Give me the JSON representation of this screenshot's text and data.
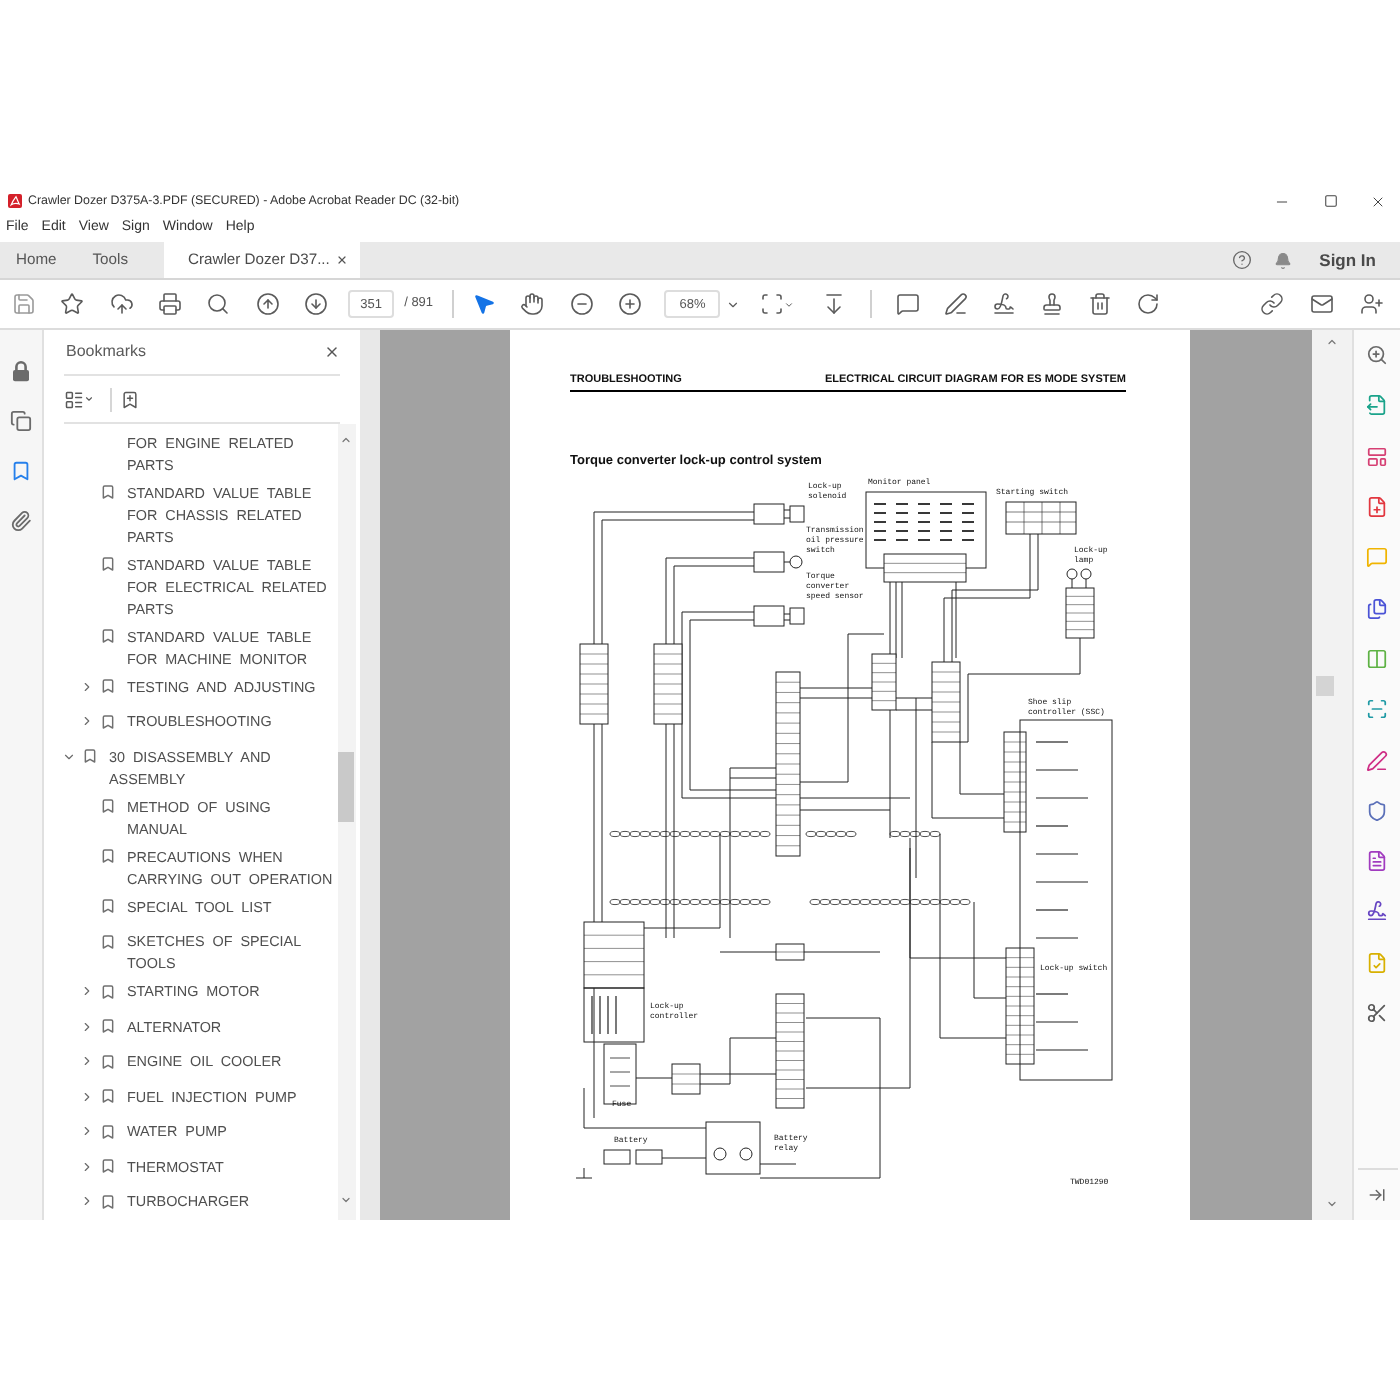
{
  "window": {
    "title": "Crawler Dozer D375A-3.PDF (SECURED) - Adobe Acrobat Reader DC (32-bit)"
  },
  "menu": [
    "File",
    "Edit",
    "View",
    "Sign",
    "Window",
    "Help"
  ],
  "tabs": [
    {
      "label": "Home",
      "selected": false
    },
    {
      "label": "Tools",
      "selected": false
    },
    {
      "label": "Crawler Dozer D37...",
      "selected": true
    }
  ],
  "sign_in": "Sign In",
  "toolbar": {
    "page_number": "351",
    "page_total": "/ 891",
    "zoom": "68%"
  },
  "left_rail": [
    {
      "selected": false
    },
    {
      "selected": false
    },
    {
      "selected": true
    },
    {
      "selected": false
    }
  ],
  "bookmarks": {
    "title": "Bookmarks",
    "items": [
      {
        "kind": "offscreen",
        "children": [
          {
            "kind": "partial",
            "label": "FOR ENGINE RELATED PARTS",
            "expanded": false
          },
          {
            "kind": "bookmark",
            "label": "STANDARD VALUE TABLE FOR CHASSIS RELATED PARTS",
            "expanded": false
          },
          {
            "kind": "bookmark",
            "label": "STANDARD VALUE TABLE FOR ELECTRICAL RELATED PARTS",
            "expanded": false
          },
          {
            "kind": "bookmark",
            "label": "STANDARD VALUE TABLE FOR MACHINE MONITOR",
            "expanded": false
          },
          {
            "kind": "folder",
            "label": "TESTING AND ADJUSTING",
            "expanded": false
          },
          {
            "kind": "folder",
            "label": "TROUBLESHOOTING",
            "expanded": false
          }
        ]
      },
      {
        "kind": "folder",
        "label": "30 DISASSEMBLY AND ASSEMBLY",
        "expanded": true,
        "children": [
          {
            "kind": "bookmark",
            "label": "METHOD OF USING MANUAL",
            "expanded": false
          },
          {
            "kind": "bookmark",
            "label": "PRECAUTIONS WHEN CARRYING OUT OPERATION",
            "expanded": false
          },
          {
            "kind": "bookmark",
            "label": "SPECIAL TOOL LIST",
            "expanded": false
          },
          {
            "kind": "bookmark",
            "label": "SKETCHES OF SPECIAL TOOLS",
            "expanded": false
          },
          {
            "kind": "folder",
            "label": "STARTING MOTOR",
            "expanded": false
          },
          {
            "kind": "folder",
            "label": "ALTERNATOR",
            "expanded": false
          },
          {
            "kind": "folder",
            "label": "ENGINE OIL COOLER",
            "expanded": false
          },
          {
            "kind": "folder",
            "label": "FUEL INJECTION PUMP",
            "expanded": false
          },
          {
            "kind": "folder",
            "label": "WATER PUMP",
            "expanded": false
          },
          {
            "kind": "folder",
            "label": "THERMOSTAT",
            "expanded": false
          },
          {
            "kind": "folder",
            "label": "TURBOCHARGER",
            "expanded": false
          }
        ]
      }
    ]
  },
  "document": {
    "header_left": "TROUBLESHOOTING",
    "header_right": "ELECTRICAL CIRCUIT DIAGRAM FOR ES MODE SYSTEM",
    "title": "Torque converter lock-up control system",
    "diagram_labels": [
      "Lock-up solenoid",
      "Monitor panel",
      "Starting switch",
      "Lock-up lamp",
      "Transmission oil pressure switch",
      "Torque converter speed sensor",
      "Shoe slip controller (SSC)",
      "Lock-up switch",
      "Lock-up controller",
      "Fuse",
      "Battery",
      "Battery relay",
      "TWD01290"
    ]
  }
}
